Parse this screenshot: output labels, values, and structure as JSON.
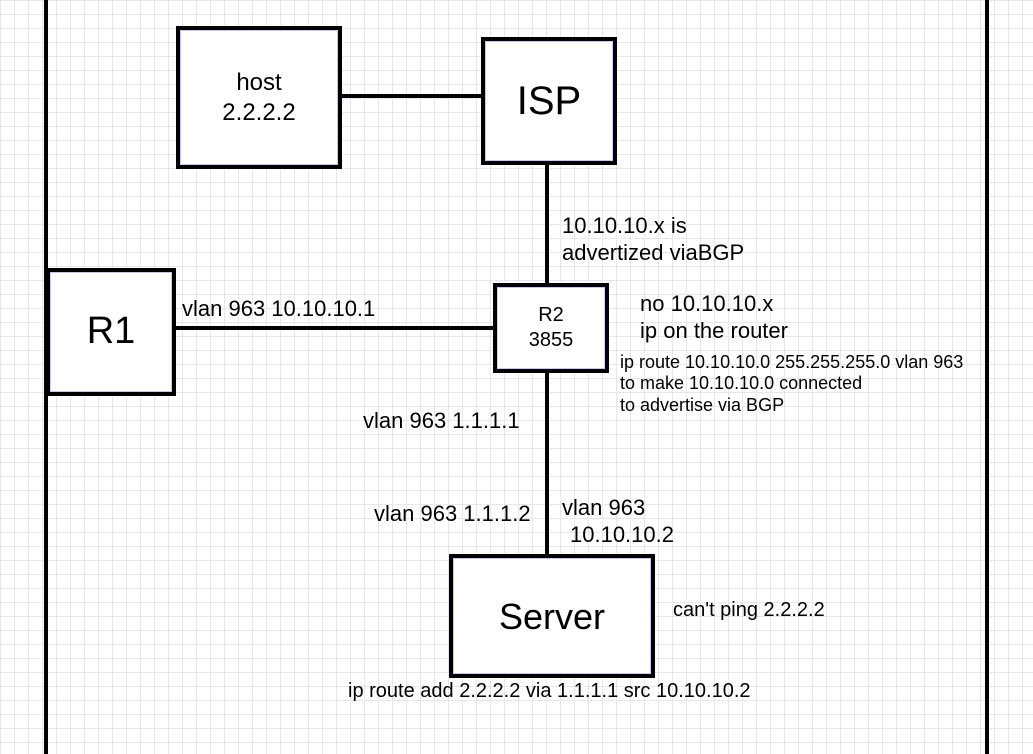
{
  "nodes": {
    "host": {
      "line1": "host",
      "line2": "2.2.2.2"
    },
    "isp": {
      "label": "ISP"
    },
    "r1": {
      "label": "R1"
    },
    "r2": {
      "line1": "R2",
      "line2": "3855"
    },
    "server": {
      "label": "Server"
    }
  },
  "labels": {
    "bgp1": "10.10.10.x is",
    "bgp2": "advertized viaBGP",
    "r1_link": "vlan 963 10.10.10.1",
    "noip1": "no 10.10.10.x",
    "noip2": "ip on the router",
    "route1": "ip route 10.10.10.0 255.255.255.0 vlan 963",
    "route2": "to make 10.10.10.0 connected",
    "route3": "to advertise via BGP",
    "top_vlan": "vlan 963 1.1.1.1",
    "bot_vlan": "vlan 963 1.1.1.2",
    "srv_vlan1": "vlan 963",
    "srv_vlan2": "10.10.10.2",
    "cant_ping": "can't ping 2.2.2.2",
    "srv_route": "ip route add 2.2.2.2 via 1.1.1.1 src 10.10.10.2"
  }
}
